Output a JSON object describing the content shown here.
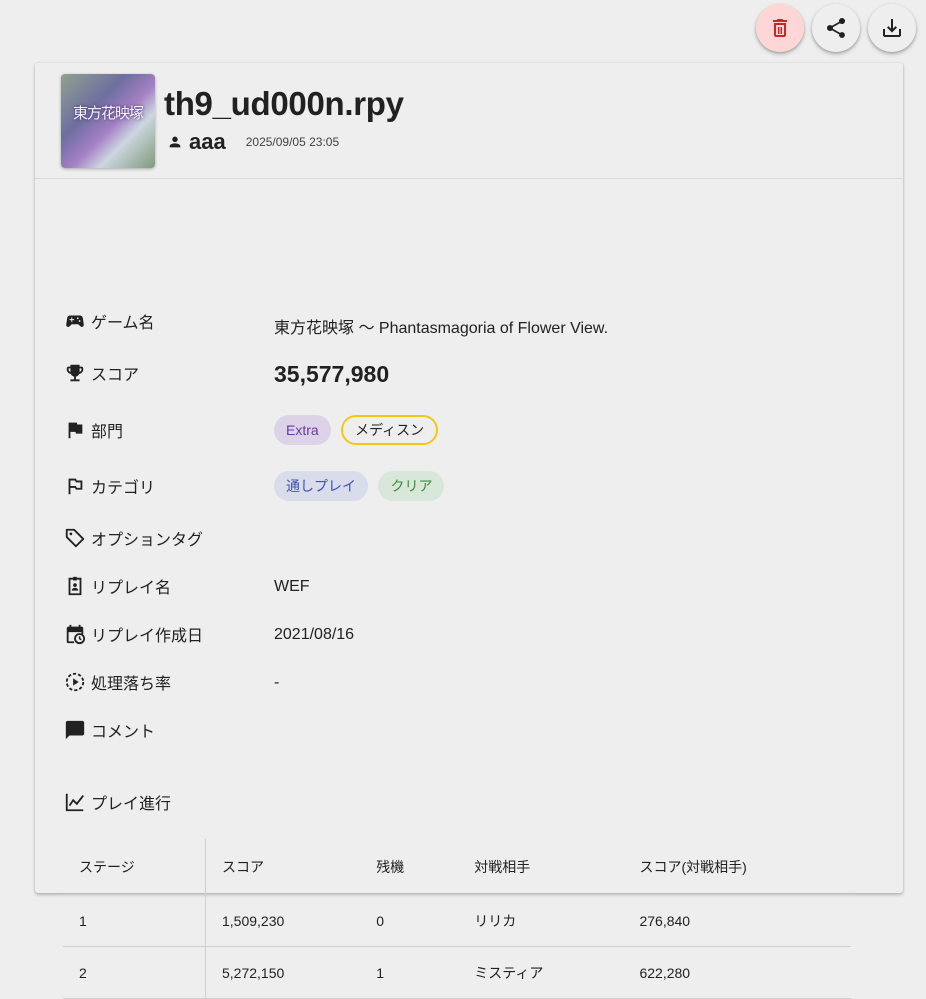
{
  "actions": {
    "delete_color": "#c62828",
    "share_icon": "share-icon",
    "download_icon": "download-icon"
  },
  "replay": {
    "filename": "th9_ud000n.rpy",
    "thumbnail_text": "東方花映塚",
    "user": "aaa",
    "uploaded_at": "2025/09/05 23:05"
  },
  "fields": {
    "game": {
      "label": "ゲーム名",
      "value": "東方花映塚 〜 Phantasmagoria of Flower View."
    },
    "score": {
      "label": "スコア",
      "value": "35,577,980"
    },
    "division": {
      "label": "部門",
      "chips": [
        {
          "text": "Extra",
          "bg": "#ddd3e8",
          "color": "#6a3aa0",
          "border": "none"
        },
        {
          "text": "メディスン",
          "bg": "#eeeeee",
          "color": "#212121",
          "border": "#f2c811"
        }
      ]
    },
    "category": {
      "label": "カテゴリ",
      "chips": [
        {
          "text": "通しプレイ",
          "bg": "#d8dceb",
          "color": "#3f51b5"
        },
        {
          "text": "クリア",
          "bg": "#d9e6da",
          "color": "#388e3c"
        }
      ]
    },
    "option_tags": {
      "label": "オプションタグ"
    },
    "replay_name": {
      "label": "リプレイ名",
      "value": "WEF"
    },
    "replay_date": {
      "label": "リプレイ作成日",
      "value": "2021/08/16"
    },
    "slowdown": {
      "label": "処理落ち率",
      "value": "-"
    },
    "comment": {
      "label": "コメント"
    }
  },
  "progress": {
    "label": "プレイ進行",
    "columns": [
      "ステージ",
      "スコア",
      "残機",
      "対戦相手",
      "スコア(対戦相手)"
    ],
    "rows": [
      [
        "1",
        "1,509,230",
        "0",
        "リリカ",
        "276,840"
      ],
      [
        "2",
        "5,272,150",
        "1",
        "ミスティア",
        "622,280"
      ]
    ]
  }
}
